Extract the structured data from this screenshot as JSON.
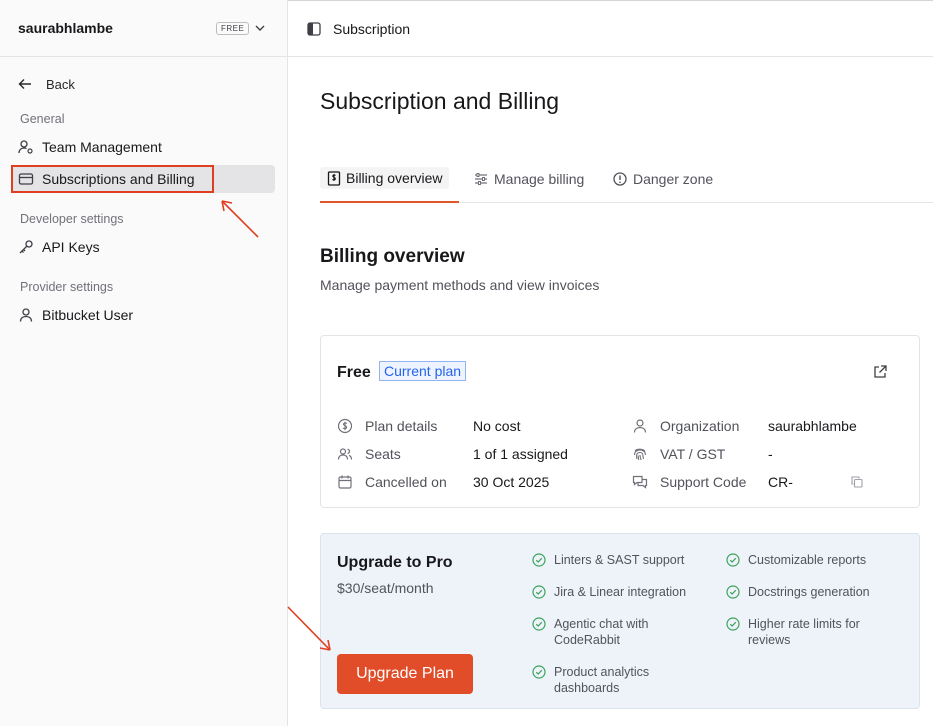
{
  "sidebar": {
    "org_name": "saurabhlambe",
    "plan_badge": "FREE",
    "back_label": "Back",
    "sections": {
      "general": "General",
      "developer": "Developer settings",
      "provider": "Provider settings"
    },
    "items": {
      "team": "Team Management",
      "billing": "Subscriptions and Billing",
      "api_keys": "API Keys",
      "bitbucket": "Bitbucket User"
    }
  },
  "topbar": {
    "title": "Subscription"
  },
  "main": {
    "title": "Subscription and Billing",
    "tabs": {
      "overview": "Billing overview",
      "manage": "Manage billing",
      "danger": "Danger zone"
    },
    "section_title": "Billing overview",
    "section_subtitle": "Manage payment methods and view invoices"
  },
  "plan": {
    "name": "Free",
    "badge": "Current plan",
    "details": {
      "plan_details_label": "Plan details",
      "plan_details_value": "No cost",
      "seats_label": "Seats",
      "seats_value": "1 of 1 assigned",
      "cancelled_label": "Cancelled on",
      "cancelled_value": "30 Oct 2025",
      "org_label": "Organization",
      "org_value": "saurabhlambe",
      "vat_label": "VAT / GST",
      "vat_value": "-",
      "support_label": "Support Code",
      "support_value": "CR-"
    }
  },
  "upgrade": {
    "title": "Upgrade to Pro",
    "price": "$30/seat/month",
    "button": "Upgrade Plan",
    "features": {
      "f1": "Linters & SAST support",
      "f2": "Jira & Linear integration",
      "f3a": "Agentic chat with",
      "f3b": "CodeRabbit",
      "f4a": "Product analytics",
      "f4b": "dashboards",
      "f5": "Customizable reports",
      "f6": "Docstrings generation",
      "f7a": "Higher rate limits for",
      "f7b": "reviews"
    }
  },
  "colors": {
    "accent": "#e04d28",
    "annotation": "#e03e20",
    "badge_blue": "#2563eb",
    "check_green": "#3aa35d"
  }
}
